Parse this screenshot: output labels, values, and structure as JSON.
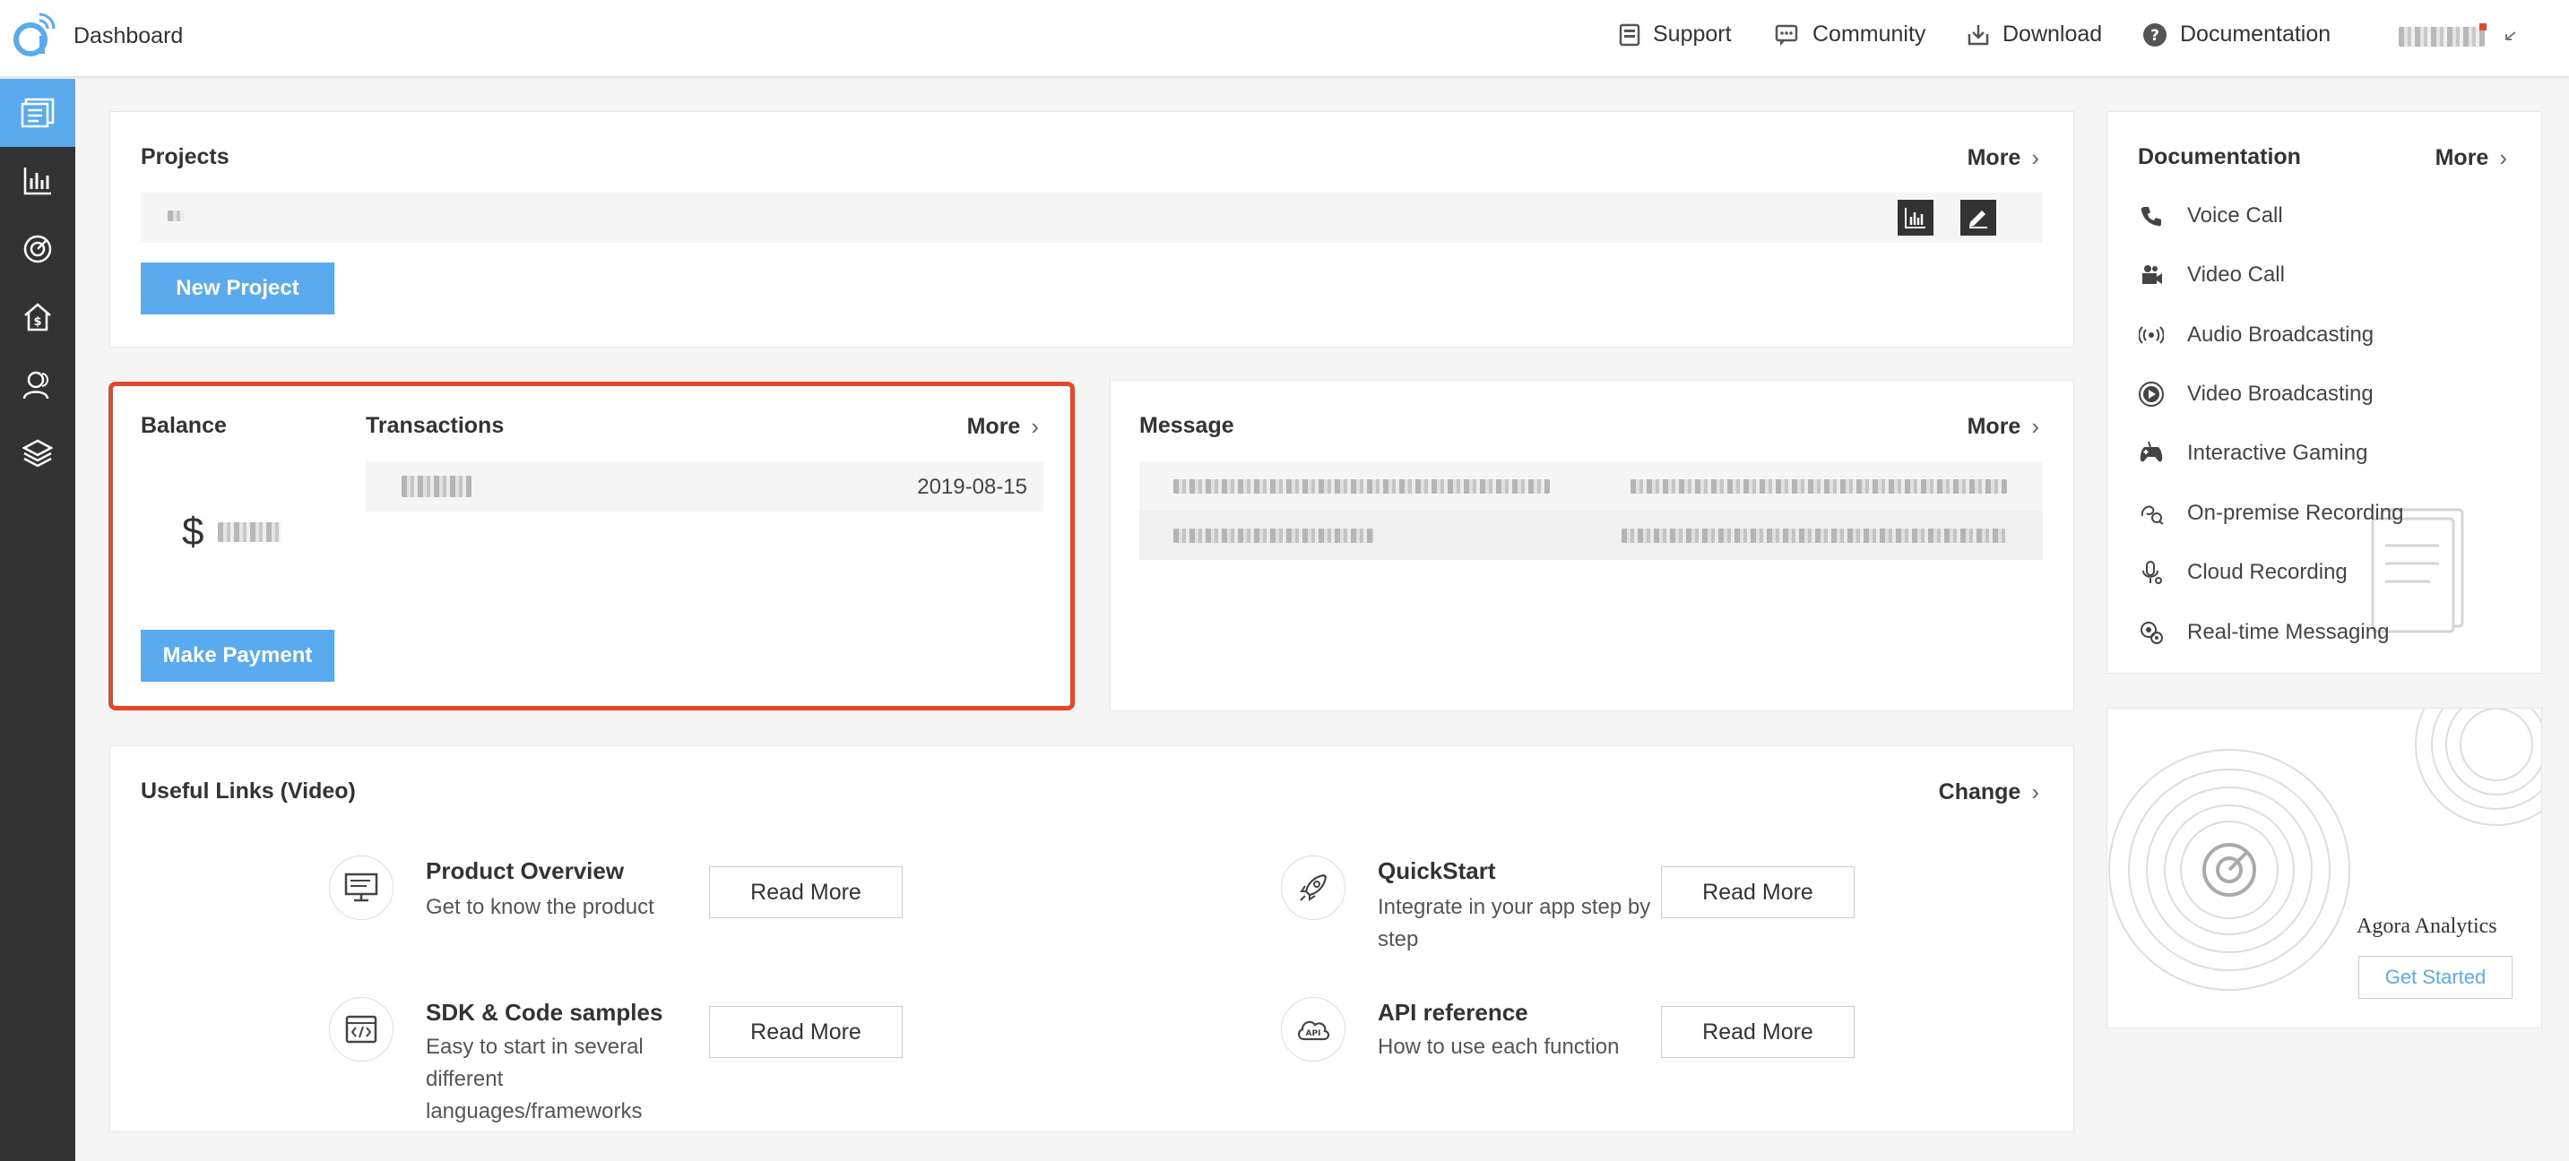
{
  "header": {
    "app_title": "Dashboard",
    "nav": [
      {
        "label": "Support",
        "icon": "support-icon"
      },
      {
        "label": "Community",
        "icon": "community-icon"
      },
      {
        "label": "Download",
        "icon": "download-icon"
      },
      {
        "label": "Documentation",
        "icon": "documentation-icon"
      }
    ]
  },
  "sidebar": {
    "items": [
      {
        "icon": "projects-icon",
        "active": true
      },
      {
        "icon": "usage-chart-icon",
        "active": false
      },
      {
        "icon": "analytics-icon",
        "active": false
      },
      {
        "icon": "billing-home-icon",
        "active": false
      },
      {
        "icon": "members-icon",
        "active": false
      },
      {
        "icon": "products-layers-icon",
        "active": false
      }
    ]
  },
  "projects": {
    "title": "Projects",
    "more": "More",
    "new_project": "New Project"
  },
  "balance": {
    "title": "Balance",
    "currency": "$",
    "make_payment": "Make Payment"
  },
  "transactions": {
    "title": "Transactions",
    "more": "More",
    "rows": [
      {
        "date": "2019-08-15"
      }
    ]
  },
  "message": {
    "title": "Message",
    "more": "More"
  },
  "useful_links": {
    "title": "Useful Links (Video)",
    "change": "Change",
    "items": [
      {
        "title": "Product Overview",
        "desc": "Get to know the product",
        "button": "Read More",
        "icon": "monitor-icon"
      },
      {
        "title": "QuickStart",
        "desc": "Integrate in your app step by step",
        "button": "Read More",
        "icon": "rocket-icon"
      },
      {
        "title": "SDK & Code samples",
        "desc": "Easy to start in several different languages/frameworks",
        "button": "Read More",
        "icon": "code-icon"
      },
      {
        "title": "API reference",
        "desc": "How to use each function",
        "button": "Read More",
        "icon": "api-cloud-icon"
      }
    ]
  },
  "documentation": {
    "title": "Documentation",
    "more": "More",
    "items": [
      {
        "label": "Voice Call",
        "icon": "phone-icon"
      },
      {
        "label": "Video Call",
        "icon": "video-camera-icon"
      },
      {
        "label": "Audio Broadcasting",
        "icon": "broadcast-icon"
      },
      {
        "label": "Video Broadcasting",
        "icon": "play-circle-icon"
      },
      {
        "label": "Interactive Gaming",
        "icon": "gamepad-icon"
      },
      {
        "label": "On-premise Recording",
        "icon": "recording-icon"
      },
      {
        "label": "Cloud Recording",
        "icon": "microphone-icon"
      },
      {
        "label": "Real-time Messaging",
        "icon": "messaging-icon"
      }
    ]
  },
  "analytics_promo": {
    "title": "Agora Analytics",
    "button": "Get Started"
  },
  "colors": {
    "primary": "#5aaaf0",
    "sidebar": "#333333",
    "highlight": "#e0492a"
  }
}
